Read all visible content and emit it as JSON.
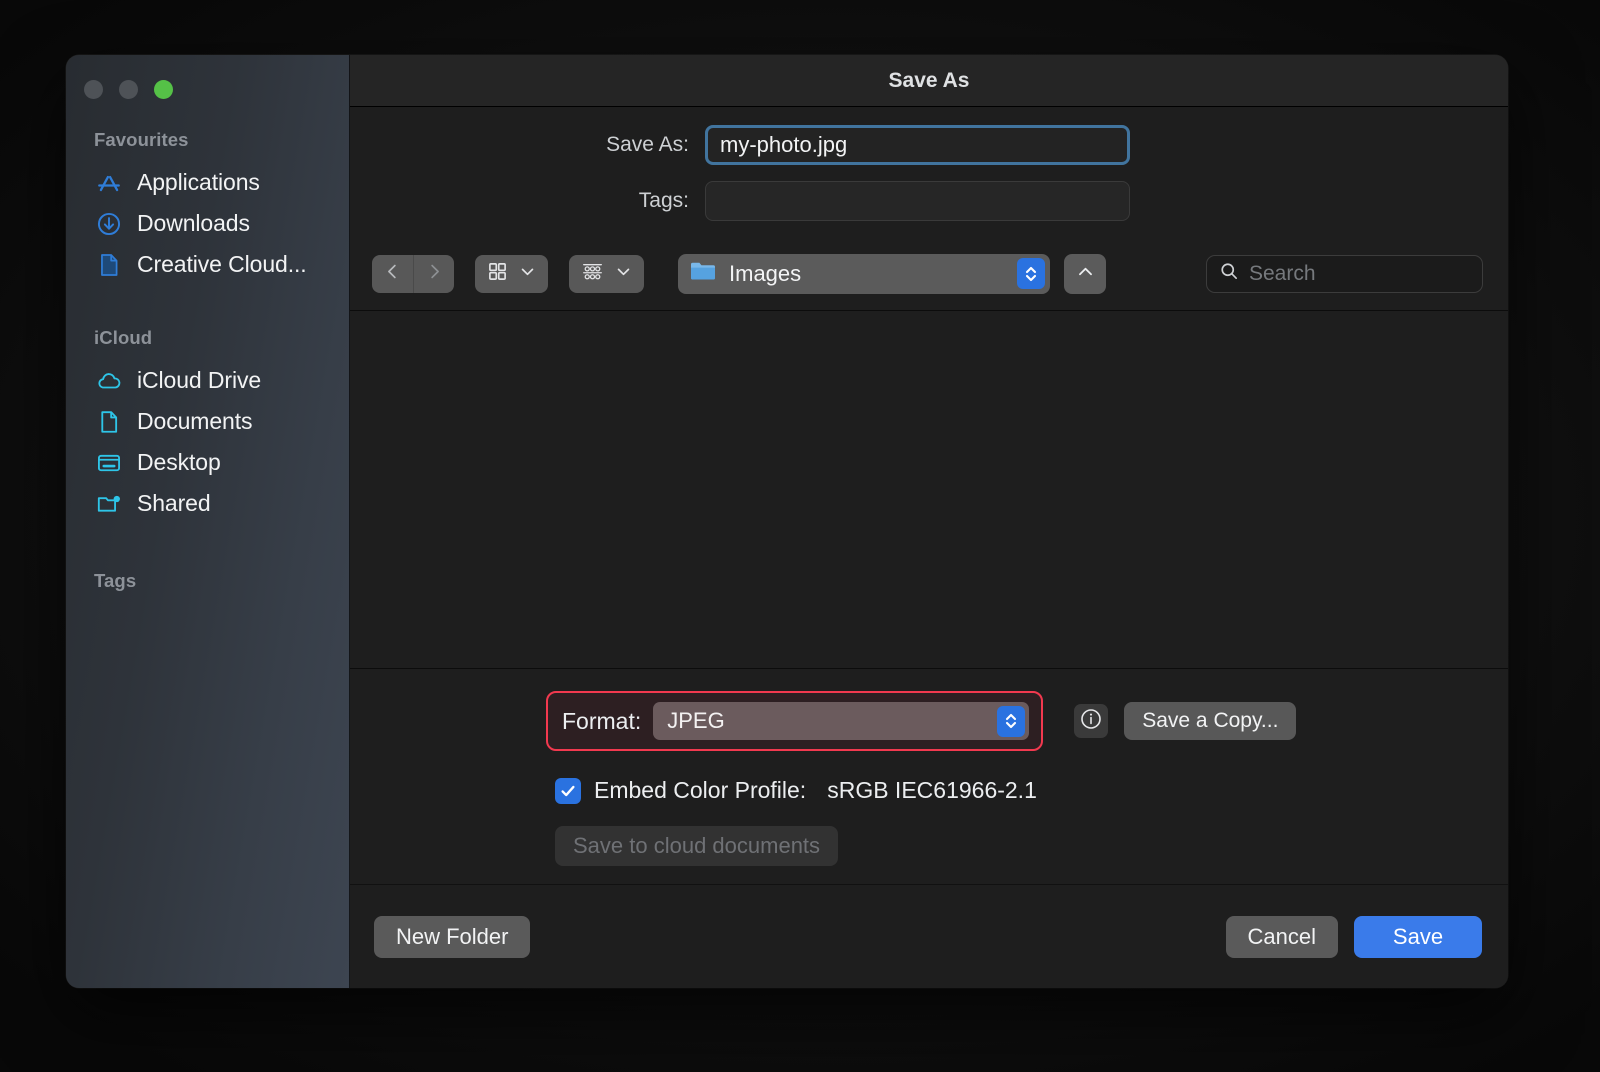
{
  "window": {
    "title": "Save As",
    "traffic_lights": [
      "close",
      "minimize",
      "zoom"
    ]
  },
  "sidebar": {
    "sections": [
      {
        "title": "Favourites",
        "items": [
          {
            "label": "Applications",
            "icon": "applications-icon",
            "color": "#2f7dd8"
          },
          {
            "label": "Downloads",
            "icon": "downloads-icon",
            "color": "#2f7dd8"
          },
          {
            "label": "Creative Cloud...",
            "icon": "document-icon",
            "color": "#2f7dd8"
          }
        ]
      },
      {
        "title": "iCloud",
        "items": [
          {
            "label": "iCloud Drive",
            "icon": "cloud-icon",
            "color": "#2ec5e8"
          },
          {
            "label": "Documents",
            "icon": "document-icon",
            "color": "#2ec5e8"
          },
          {
            "label": "Desktop",
            "icon": "desktop-icon",
            "color": "#2ec5e8"
          },
          {
            "label": "Shared",
            "icon": "shared-folder-icon",
            "color": "#2ec5e8"
          }
        ]
      },
      {
        "title": "Tags",
        "items": []
      }
    ]
  },
  "fields": {
    "save_as_label": "Save As:",
    "save_as_value": "my-photo.jpg",
    "tags_label": "Tags:",
    "tags_value": "",
    "tags_placeholder": ""
  },
  "toolbar": {
    "back_icon": "chevron-left-icon",
    "forward_icon": "chevron-right-icon",
    "icon_view_icon": "grid-view-icon",
    "group_view_icon": "group-view-icon",
    "view_dropdown_icon": "chevron-down-icon",
    "path_popup_value": "Images",
    "path_popup_icon": "folder-icon",
    "stepper_icon": "up-down-stepper-icon",
    "up_button_icon": "chevron-up-icon",
    "search_placeholder": "Search",
    "search_value": "",
    "search_icon": "search-icon"
  },
  "options": {
    "format_label": "Format:",
    "format_value": "JPEG",
    "format_highlight_color": "#f2394f",
    "info_icon": "info-circle-icon",
    "save_copy_label": "Save a Copy...",
    "embed_checkbox_checked": true,
    "embed_label": "Embed Color Profile:",
    "embed_value": "sRGB IEC61966-2.1",
    "cloud_button_label": "Save to cloud documents",
    "cloud_button_disabled": true
  },
  "footer": {
    "new_folder_label": "New Folder",
    "cancel_label": "Cancel",
    "save_label": "Save",
    "save_accent_color": "#3a7bea"
  }
}
